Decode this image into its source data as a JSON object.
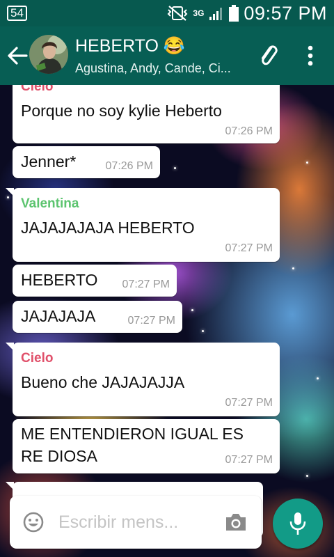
{
  "status_bar": {
    "badge": "54",
    "network": "3G",
    "time": "09:57 PM"
  },
  "chat": {
    "title": "HEBERTO 😂",
    "subtitle": "Agustina, Andy, Cande, Ci..."
  },
  "messages": [
    {
      "sender": "Cielo",
      "text": "Porque no soy kylie Heberto",
      "time": "07:26 PM"
    },
    {
      "text": "Jenner*",
      "time": "07:26 PM"
    },
    {
      "sender": "Valentina",
      "text": "JAJAJAJAJA HEBERTO",
      "time": "07:27 PM"
    },
    {
      "text": "HEBERTO",
      "time": "07:27 PM"
    },
    {
      "text": "JAJAJAJA",
      "time": "07:27 PM"
    },
    {
      "sender": "Cielo",
      "text": "Bueno che JAJAJAJJA",
      "time": "07:27 PM"
    },
    {
      "text_line1": "ME ENTENDIERON IGUAL ES",
      "text_line2": "RE DIOSA",
      "time": "07:27 PM"
    }
  ],
  "input": {
    "placeholder": "Escribir mens..."
  },
  "colors": {
    "header": "#075e54",
    "status_bar": "#07594f",
    "accent": "#129b87",
    "cielo_name": "#e0506a",
    "valentina_name": "#5cc46f"
  },
  "icons": [
    "back-arrow-icon",
    "attach-icon",
    "more-vert-icon",
    "emoji-icon",
    "camera-icon",
    "mic-icon"
  ]
}
